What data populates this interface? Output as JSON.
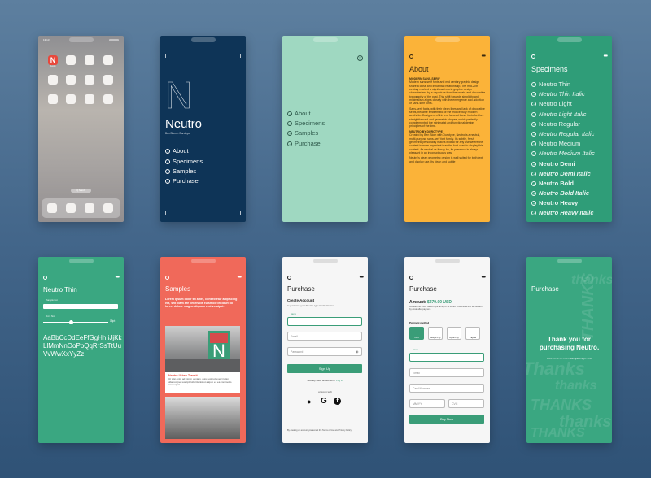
{
  "p1": {
    "time": "13:13",
    "app_label": "Neutro",
    "n_letter": "N",
    "search": "Q Search"
  },
  "p2": {
    "title": "Neutro",
    "subtitle": "Ben Blom × Durotype",
    "big_letter": "N",
    "menu": [
      "About",
      "Specimens",
      "Samples",
      "Purchase"
    ]
  },
  "p3": {
    "menu": [
      "About",
      "Specimens",
      "Samples",
      "Purchase"
    ]
  },
  "p4": {
    "title": "About",
    "h1": "MODERN SANS-SERIF",
    "p1": "Modern sans-serif fonts and mid century graphic design share a close and influential relationship. The mid-20th century marked a significant era in graphic design characterized by a departure from the ornate and decorative typography of the past. This shift towards simplicity and minimalism aligns closely with the emergence and adoption of sans-serif fonts.",
    "p2": "Sans-serif fonts, with their clean lines and lack of decorative serifs, became emblematic of the mid-century modern aesthetic. Designers of this era favored these fonts for their straightforward and geometric shapes, which perfectly complemented the minimalist and functional design principles of the time.",
    "h2": "NEUTRO BY DUROTYPE",
    "p3": "Created by Ben Blom with Durotype, Neutro is a neutral, multi-purpose sans-serif font family. Its subtle, fresh geometric personality makes it ideal for any use where the content is more important than the font used to display this content. As neutral as it may be, its presence is always pleasant in an inconspicuous way.",
    "p4": "Neutro's clean geometric design is well suited for both text and display use. Its clean and subtle"
  },
  "p5": {
    "title": "Specimens",
    "items": [
      "Neutro Thin",
      "Neutro Thin Italic",
      "Neutro Light",
      "Neutro Light Italic",
      "Neutro Regular",
      "Neutro Regular Italic",
      "Neutro Medium",
      "Neutro Medium Italic",
      "Neutro Demi",
      "Neutro Demi Italic",
      "Neutro Bold",
      "Neutro Bold Italic",
      "Neutro Heavy",
      "Neutro Heavy Italic"
    ]
  },
  "p6": {
    "title": "Neutro Thin",
    "sample_label": "Sample text",
    "font_size_label": "Font Size",
    "size_value": "15pt",
    "alphabet": [
      "AaBbCcDdEeFfGgHhIiJjKk",
      "LlMmNnOoPpQqRrSsTtUu",
      "VvWwXxYyZz"
    ]
  },
  "p7": {
    "title": "Samples",
    "intro": "Lorem ipsum dolor sit amet, consectetur adipiscing elit, sed diam are venenatis euismod tincidunt id loreet dolore magna aliquam erat volutpat.",
    "card_title": "Neutro Urban Transit",
    "card_text": "Ut wisi enim ad minim veniam, quis nostrud exerci tation ullamcorper suscipit lobortis nisl ut aliquip ex ea commodo consequat.",
    "poster_letter": "N"
  },
  "p8": {
    "title": "Purchase",
    "heading": "Create Account",
    "sub": "to purchase your Neutro type family license",
    "name_label": "Name",
    "email_ph": "Email",
    "password_ph": "Password",
    "signup": "Sign Up",
    "have_account": "Already have an account?",
    "login": "Log in",
    "or": "or log in with",
    "terms": "By creating an account you accept the Terms of Use and Privacy Policy"
  },
  "p9": {
    "title": "Purchase",
    "amount_label": "Amount:",
    "amount": "$279.00 USD",
    "note": "Includes the entire Neutro type family of 14 styles. A download link will be sent by email after payment.",
    "payment_label": "Payment method",
    "methods": [
      "Card",
      "Google Pay",
      "Apple Pay",
      "PayPal"
    ],
    "name_label": "Name",
    "email_ph": "Email",
    "card_ph": "Card Number",
    "mmyy_ph": "MM/YY",
    "cvc_ph": "CVC",
    "buy": "Buy Now"
  },
  "p10": {
    "title": "Purchase",
    "heading1": "Thank you for",
    "heading2": "purchasing Neutro.",
    "sub": "A link has been sent to",
    "email": "info@durotype.com",
    "ghost": [
      "thanks",
      "THANKS",
      "Thanks",
      "thanks",
      "THANKS",
      "thanks",
      "THANKS"
    ]
  },
  "colors": {
    "navy": "#0e3457",
    "mint": "#9fd8c1",
    "orange": "#fbb339",
    "green": "#2f9d78",
    "coral": "#f0695a",
    "buttonGreen": "#3a9d78"
  }
}
